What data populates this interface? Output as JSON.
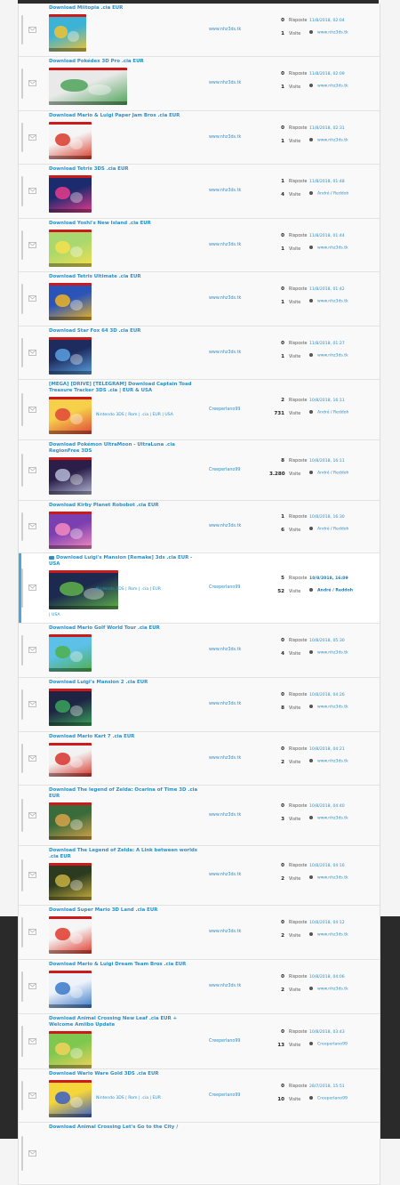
{
  "labels": {
    "replies": "Risposte",
    "views": "Visite"
  },
  "colors": {
    "link": "#2a8fc9",
    "highlight_bar": "#4aa8d8",
    "footer_bg": "#2a2a2a"
  },
  "topics": [
    {
      "title": "Download Miitopia .cia EUR",
      "author": "www.nhz3ds.tk",
      "replies": "0",
      "views": "1",
      "last_date": "11/8/2018, 02:04",
      "last_by": "www.nhz3ds.tk",
      "c1": "#3cb2d6",
      "c2": "#f2c230"
    },
    {
      "title": "Download Pokédex 3D Pro .cia EUR",
      "author": "www.nhz3ds.tk",
      "replies": "0",
      "views": "1",
      "last_date": "11/8/2018, 02:09",
      "last_by": "www.nhz3ds.tk",
      "c1": "#e9e9e9",
      "c2": "#4fa35a"
    },
    {
      "title": "Download Mario & Luigi Paper Jam Bros .cia EUR",
      "author": "www.nhz3ds.tk",
      "replies": "0",
      "views": "1",
      "last_date": "11/8/2018, 02:31",
      "last_by": "www.nhz3ds.tk",
      "c1": "#f5f5f5",
      "c2": "#d93a2b"
    },
    {
      "title": "Download Tetris 3DS .cia EUR",
      "author": "www.nhz3ds.tk",
      "replies": "1",
      "views": "4",
      "last_date": "11/8/2018, 01:48",
      "last_by": "André / Reddoh",
      "c1": "#1c2a6e",
      "c2": "#e63b8b"
    },
    {
      "title": "Download Yoshi's New Island .cia EUR",
      "author": "www.nhz3ds.tk",
      "replies": "0",
      "views": "1",
      "last_date": "11/8/2018, 01:44",
      "last_by": "www.nhz3ds.tk",
      "c1": "#a8d86e",
      "c2": "#f4e04d"
    },
    {
      "title": "Download Tetris Ultimate .cia EUR",
      "author": "www.nhz3ds.tk",
      "replies": "0",
      "views": "1",
      "last_date": "11/8/2018, 01:42",
      "last_by": "www.nhz3ds.tk",
      "c1": "#2a54b8",
      "c2": "#f0b423"
    },
    {
      "title": "Download Star Fox 64 3D .cia EUR",
      "author": "www.nhz3ds.tk",
      "replies": "0",
      "views": "1",
      "last_date": "11/8/2018, 01:27",
      "last_by": "www.nhz3ds.tk",
      "c1": "#1d2b5e",
      "c2": "#5aa0e0"
    },
    {
      "title": "[MEGA] [DRIVE] [TELEGRAM] Download Captain Toad Treasure Tracker 3DS .cia | EUR & USA",
      "tags": "Nintendo 3DS | Rom | .cia | EUR | USA",
      "author": "Creeperlano99",
      "replies": "2",
      "views": "731",
      "last_date": "10/8/2018, 16:11",
      "last_by": "André / Reddoh",
      "c1": "#f6d04a",
      "c2": "#e0463a"
    },
    {
      "title": "Download Pokémon UltraMoon - UltraLuna .cia RegionFree 3DS",
      "author": "Creeperlano99",
      "replies": "8",
      "views": "3.280",
      "last_date": "10/8/2018, 16:11",
      "last_by": "André / Reddoh",
      "c1": "#2b1f4a",
      "c2": "#b5b9d6"
    },
    {
      "title": "Download Kirby Planet Robobot .cia EUR",
      "author": "www.nhz3ds.tk",
      "replies": "1",
      "views": "6",
      "last_date": "10/8/2018, 16:30",
      "last_by": "André / Reddoh",
      "c1": "#7a3fb0",
      "c2": "#f48ac0"
    },
    {
      "title": "Download Luigi's Mansion [Remake] 3ds .cia EUR - USA",
      "tags": "Nintendo 3DS | Rom | .cia | EUR",
      "tags_sub": "| USA",
      "author": "Creeperlano99",
      "replies": "5",
      "views": "52",
      "last_date": "10/8/2018, 16:09",
      "last_by": "André / Reddoh",
      "highlight": true,
      "c1": "#1b2a4e",
      "c2": "#5fb14a"
    },
    {
      "title": "Download Mario Golf World Tour .cia EUR",
      "author": "www.nhz3ds.tk",
      "replies": "0",
      "views": "4",
      "last_date": "10/8/2018, 05:30",
      "last_by": "www.nhz3ds.tk",
      "c1": "#5cc0e8",
      "c2": "#4fb049"
    },
    {
      "title": "Download Luigi's Mansion 2 .cia EUR",
      "author": "www.nhz3ds.tk",
      "replies": "0",
      "views": "8",
      "last_date": "10/8/2018, 04:26",
      "last_by": "www.nhz3ds.tk",
      "c1": "#1e2444",
      "c2": "#3aa35a"
    },
    {
      "title": "Download Mario Kart 7 .cia EUR",
      "author": "www.nhz3ds.tk",
      "replies": "0",
      "views": "2",
      "last_date": "10/8/2018, 04:21",
      "last_by": "www.nhz3ds.tk",
      "c1": "#f2f2f2",
      "c2": "#d7342a"
    },
    {
      "title": "Download The legend of Zelda: Ocarina of Time 3D .cia EUR",
      "author": "www.nhz3ds.tk",
      "replies": "0",
      "views": "3",
      "last_date": "10/8/2018, 04:40",
      "last_by": "www.nhz3ds.tk",
      "c1": "#3a6b3a",
      "c2": "#d8a34a"
    },
    {
      "title": "Download The Legend of Zelda: A Link between worlds .cia EUR",
      "author": "www.nhz3ds.tk",
      "replies": "0",
      "views": "2",
      "last_date": "10/8/2018, 04:16",
      "last_by": "www.nhz3ds.tk",
      "c1": "#2c3b1f",
      "c2": "#c8b040"
    },
    {
      "title": "Download Super Mario 3D Land .cia EUR",
      "author": "www.nhz3ds.tk",
      "replies": "0",
      "views": "2",
      "last_date": "10/8/2018, 04:12",
      "last_by": "www.nhz3ds.tk",
      "c1": "#f5f5f5",
      "c2": "#e03a2c"
    },
    {
      "title": "Download Mario & Luigi Dream Team Bros .cia EUR",
      "author": "www.nhz3ds.tk",
      "replies": "0",
      "views": "2",
      "last_date": "10/8/2018, 04:06",
      "last_by": "www.nhz3ds.tk",
      "c1": "#eef3fa",
      "c2": "#3a78c8"
    },
    {
      "title": "Download Animal Crossing New Leaf .cia EUR + Welcome Amiibo Update",
      "author": "Creeperlano99",
      "replies": "0",
      "views": "13",
      "last_date": "10/8/2018, 03:43",
      "last_by": "Creeperlano99",
      "c1": "#7ec850",
      "c2": "#f0d25a"
    },
    {
      "title": "Download Wario Ware Gold 3DS .cia EUR",
      "tags": "Nintendo 3DS | Rom | .cia | EUR",
      "author": "Creeperlano99",
      "replies": "0",
      "views": "10",
      "last_date": "28/7/2018, 15:51",
      "last_by": "Creeperlano99",
      "c1": "#f4d53a",
      "c2": "#3a5fc8"
    },
    {
      "title": "Download Animal Crossing Let's Go to the City /",
      "author": "",
      "replies": "",
      "views": "",
      "last_date": "",
      "last_by": "",
      "c1": "#7ec850",
      "c2": "#f0d25a"
    }
  ]
}
